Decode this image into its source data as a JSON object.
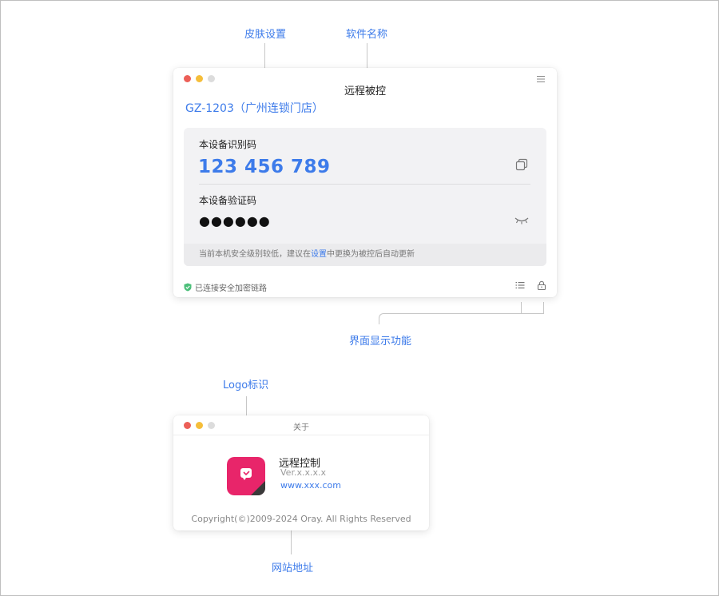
{
  "annotations": {
    "skin": "皮肤设置",
    "software_name": "软件名称",
    "display_functions": "界面显示功能",
    "logo": "Logo标识",
    "website": "网站地址"
  },
  "main_window": {
    "title": "远程被控",
    "device_name": "GZ-1203（广州连锁门店）",
    "id_label": "本设备识别码",
    "id_code": "123 456 789",
    "verify_label": "本设备验证码",
    "verify_code": "●●●●●●",
    "notice_before": "当前本机安全级别较低，建议在",
    "notice_link": "设置",
    "notice_after": "中更换为被控后自动更新",
    "status": "已连接安全加密链路"
  },
  "about_window": {
    "title": "关于",
    "app_name": "远程控制",
    "version": "Ver.x.x.x.x",
    "website": "www.xxx.com",
    "copyright": "Copyright(©)2009-2024 Oray. All Rights Reserved"
  },
  "colors": {
    "accent": "#3d7bea",
    "close": "#ec5f58",
    "minimize": "#f5be3a",
    "maximize": "#dcdcdc",
    "shield": "#4cbf7a",
    "logo": "#e8256a"
  },
  "icons": [
    "menu-icon",
    "copy-icon",
    "eye-closed-icon",
    "shield-icon",
    "list-icon",
    "lock-icon",
    "app-logo-icon"
  ]
}
